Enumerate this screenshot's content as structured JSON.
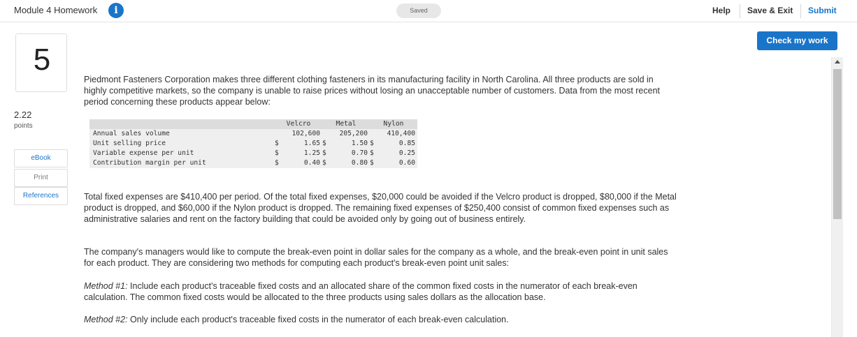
{
  "header": {
    "module_title": "Module 4 Homework",
    "info_icon": "info-icon",
    "saved_status": "Saved",
    "help": "Help",
    "save_exit": "Save & Exit",
    "submit": "Submit"
  },
  "sidebar": {
    "question_number": "5",
    "points_value": "2.22",
    "points_label": "points",
    "ebook": "eBook",
    "print": "Print",
    "references": "References"
  },
  "check_my_work": "Check my work",
  "question": {
    "intro": "Piedmont Fasteners Corporation makes three different clothing fasteners in its manufacturing facility in North Carolina. All three products are sold in highly competitive markets, so the company is unable to raise prices without losing an unacceptable number of customers. Data from the most recent period concerning these products appear below:",
    "table": {
      "columns": [
        "Velcro",
        "Metal",
        "Nylon"
      ],
      "rows": [
        {
          "label": "Annual sales volume",
          "velcro": "102,600",
          "metal": "205,200",
          "nylon": "410,400"
        },
        {
          "label": "Unit selling price",
          "velcro_sym": "$",
          "velcro": "1.65",
          "metal_sym": "$",
          "metal": "1.50",
          "nylon_sym": "$",
          "nylon": "0.85"
        },
        {
          "label": "Variable expense per unit",
          "velcro_sym": "$",
          "velcro": "1.25",
          "metal_sym": "$",
          "metal": "0.70",
          "nylon_sym": "$",
          "nylon": "0.25"
        },
        {
          "label": "Contribution margin per unit",
          "velcro_sym": "$",
          "velcro": "0.40",
          "metal_sym": "$",
          "metal": "0.80",
          "nylon_sym": "$",
          "nylon": "0.60"
        }
      ]
    },
    "fixed_expenses": "Total fixed expenses are $410,400 per period. Of the total fixed expenses, $20,000 could be avoided if the Velcro product is dropped, $80,000 if the Metal product is dropped, and $60,000 if the Nylon product is dropped. The remaining fixed expenses of $250,400 consist of common fixed expenses such as administrative salaries and rent on the factory building that could be avoided only by going out of business entirely.",
    "managers": "The company's managers would like to compute the break-even point in dollar sales for the company as a whole, and the break-even point in unit sales for each product. They are considering two methods for computing each product's break-even point unit sales:",
    "method1_label": "Method #1:",
    "method1_text": " Include each product's traceable fixed costs and an allocated share of the common fixed costs in the numerator of each break-even calculation. The common fixed costs would be allocated to the three products using sales dollars as the allocation base.",
    "method2_label": "Method #2:",
    "method2_text": " Only include each product's traceable fixed costs in the numerator of each break-even calculation."
  }
}
